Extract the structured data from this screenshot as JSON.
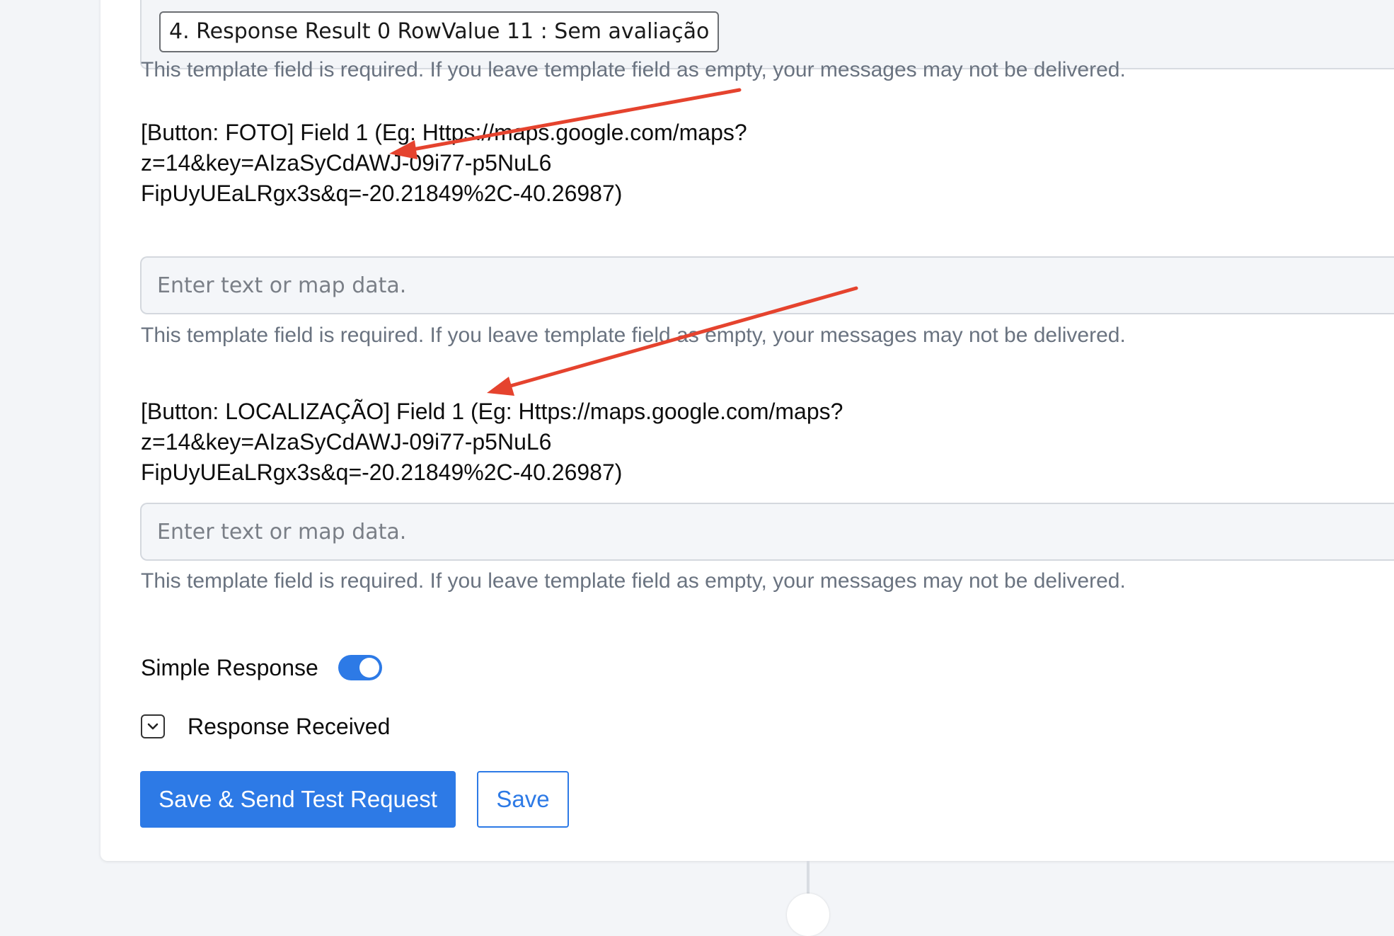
{
  "previous_field": {
    "selected_value": "4. Response Result 0 RowValue 11 : Sem avaliação"
  },
  "helper_text": "This template field is required. If you leave template field as empty, your messages may not be delivered.",
  "fields": [
    {
      "label_lines": [
        "[Button: FOTO] Field 1 (Eg: Https://maps.google.com/maps?",
        "z=14&key=AIzaSyCdAWJ-09i77-p5NuL6",
        "FipUyUEaLRgx3s&q=-20.21849%2C-40.26987)"
      ],
      "placeholder": "Enter text or map data.",
      "value": ""
    },
    {
      "label_lines": [
        "[Button: LOCALIZAÇÃO] Field 1 (Eg: Https://maps.google.com/maps?",
        "z=14&key=AIzaSyCdAWJ-09i77-p5NuL6",
        "FipUyUEaLRgx3s&q=-20.21849%2C-40.26987)"
      ],
      "placeholder": "Enter text or map data.",
      "value": ""
    }
  ],
  "simple_response": {
    "label": "Simple Response",
    "enabled": true
  },
  "response_received": {
    "label": "Response Received",
    "expanded": false
  },
  "buttons": {
    "save_and_test": "Save & Send Test Request",
    "save": "Save"
  },
  "colors": {
    "accent": "#2d7ae6",
    "annotation_arrow": "#e5432e",
    "helper_text": "#6a7380",
    "page_background": "#f3f5f8"
  },
  "icons": {
    "collapse_toggle": "chevron-down-icon"
  }
}
